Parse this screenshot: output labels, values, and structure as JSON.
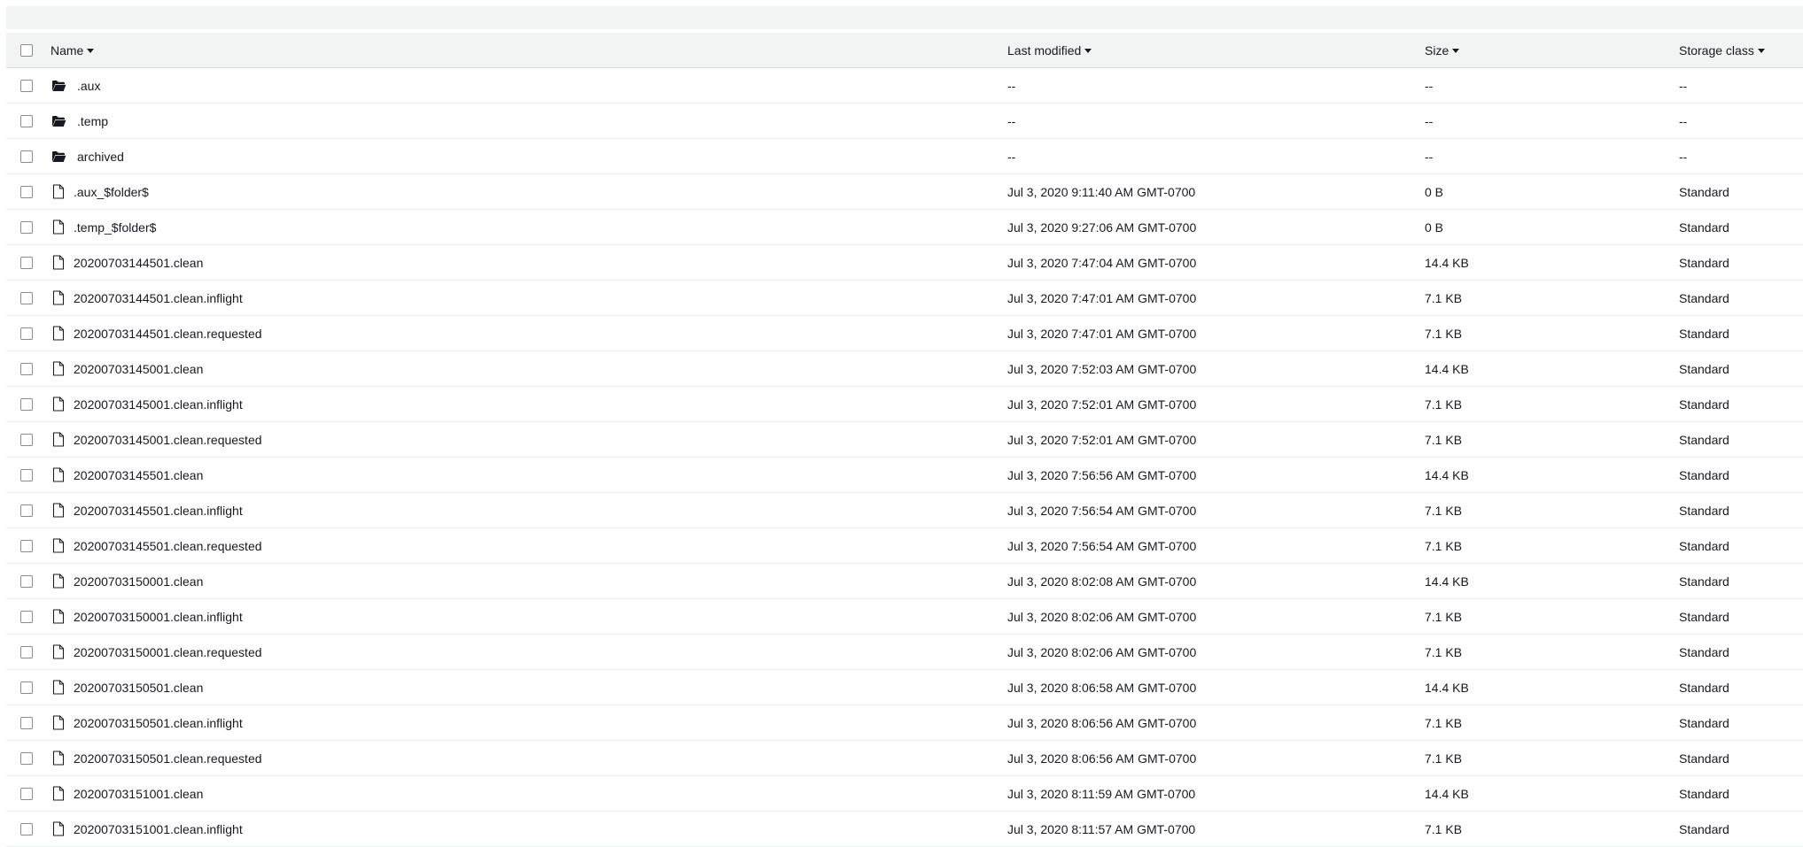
{
  "table": {
    "columns": {
      "name": "Name",
      "last_modified": "Last modified",
      "size": "Size",
      "storage_class": "Storage class"
    },
    "rows": [
      {
        "type": "folder",
        "icon": "folder-open-icon",
        "name": ".aux",
        "last_modified": "--",
        "size": "--",
        "storage_class": "--"
      },
      {
        "type": "folder",
        "icon": "folder-open-icon",
        "name": ".temp",
        "last_modified": "--",
        "size": "--",
        "storage_class": "--"
      },
      {
        "type": "folder",
        "icon": "folder-open-icon",
        "name": "archived",
        "last_modified": "--",
        "size": "--",
        "storage_class": "--"
      },
      {
        "type": "file",
        "icon": "file-icon",
        "name": ".aux_$folder$",
        "last_modified": "Jul 3, 2020 9:11:40 AM GMT-0700",
        "size": "0 B",
        "storage_class": "Standard"
      },
      {
        "type": "file",
        "icon": "file-icon",
        "name": ".temp_$folder$",
        "last_modified": "Jul 3, 2020 9:27:06 AM GMT-0700",
        "size": "0 B",
        "storage_class": "Standard"
      },
      {
        "type": "file",
        "icon": "file-icon",
        "name": "20200703144501.clean",
        "last_modified": "Jul 3, 2020 7:47:04 AM GMT-0700",
        "size": "14.4 KB",
        "storage_class": "Standard"
      },
      {
        "type": "file",
        "icon": "file-icon",
        "name": "20200703144501.clean.inflight",
        "last_modified": "Jul 3, 2020 7:47:01 AM GMT-0700",
        "size": "7.1 KB",
        "storage_class": "Standard"
      },
      {
        "type": "file",
        "icon": "file-icon",
        "name": "20200703144501.clean.requested",
        "last_modified": "Jul 3, 2020 7:47:01 AM GMT-0700",
        "size": "7.1 KB",
        "storage_class": "Standard"
      },
      {
        "type": "file",
        "icon": "file-icon",
        "name": "20200703145001.clean",
        "last_modified": "Jul 3, 2020 7:52:03 AM GMT-0700",
        "size": "14.4 KB",
        "storage_class": "Standard"
      },
      {
        "type": "file",
        "icon": "file-icon",
        "name": "20200703145001.clean.inflight",
        "last_modified": "Jul 3, 2020 7:52:01 AM GMT-0700",
        "size": "7.1 KB",
        "storage_class": "Standard"
      },
      {
        "type": "file",
        "icon": "file-icon",
        "name": "20200703145001.clean.requested",
        "last_modified": "Jul 3, 2020 7:52:01 AM GMT-0700",
        "size": "7.1 KB",
        "storage_class": "Standard"
      },
      {
        "type": "file",
        "icon": "file-icon",
        "name": "20200703145501.clean",
        "last_modified": "Jul 3, 2020 7:56:56 AM GMT-0700",
        "size": "14.4 KB",
        "storage_class": "Standard"
      },
      {
        "type": "file",
        "icon": "file-icon",
        "name": "20200703145501.clean.inflight",
        "last_modified": "Jul 3, 2020 7:56:54 AM GMT-0700",
        "size": "7.1 KB",
        "storage_class": "Standard"
      },
      {
        "type": "file",
        "icon": "file-icon",
        "name": "20200703145501.clean.requested",
        "last_modified": "Jul 3, 2020 7:56:54 AM GMT-0700",
        "size": "7.1 KB",
        "storage_class": "Standard"
      },
      {
        "type": "file",
        "icon": "file-icon",
        "name": "20200703150001.clean",
        "last_modified": "Jul 3, 2020 8:02:08 AM GMT-0700",
        "size": "14.4 KB",
        "storage_class": "Standard"
      },
      {
        "type": "file",
        "icon": "file-icon",
        "name": "20200703150001.clean.inflight",
        "last_modified": "Jul 3, 2020 8:02:06 AM GMT-0700",
        "size": "7.1 KB",
        "storage_class": "Standard"
      },
      {
        "type": "file",
        "icon": "file-icon",
        "name": "20200703150001.clean.requested",
        "last_modified": "Jul 3, 2020 8:02:06 AM GMT-0700",
        "size": "7.1 KB",
        "storage_class": "Standard"
      },
      {
        "type": "file",
        "icon": "file-icon",
        "name": "20200703150501.clean",
        "last_modified": "Jul 3, 2020 8:06:58 AM GMT-0700",
        "size": "14.4 KB",
        "storage_class": "Standard"
      },
      {
        "type": "file",
        "icon": "file-icon",
        "name": "20200703150501.clean.inflight",
        "last_modified": "Jul 3, 2020 8:06:56 AM GMT-0700",
        "size": "7.1 KB",
        "storage_class": "Standard"
      },
      {
        "type": "file",
        "icon": "file-icon",
        "name": "20200703150501.clean.requested",
        "last_modified": "Jul 3, 2020 8:06:56 AM GMT-0700",
        "size": "7.1 KB",
        "storage_class": "Standard"
      },
      {
        "type": "file",
        "icon": "file-icon",
        "name": "20200703151001.clean",
        "last_modified": "Jul 3, 2020 8:11:59 AM GMT-0700",
        "size": "14.4 KB",
        "storage_class": "Standard"
      },
      {
        "type": "file",
        "icon": "file-icon",
        "name": "20200703151001.clean.inflight",
        "last_modified": "Jul 3, 2020 8:11:57 AM GMT-0700",
        "size": "7.1 KB",
        "storage_class": "Standard"
      }
    ]
  }
}
